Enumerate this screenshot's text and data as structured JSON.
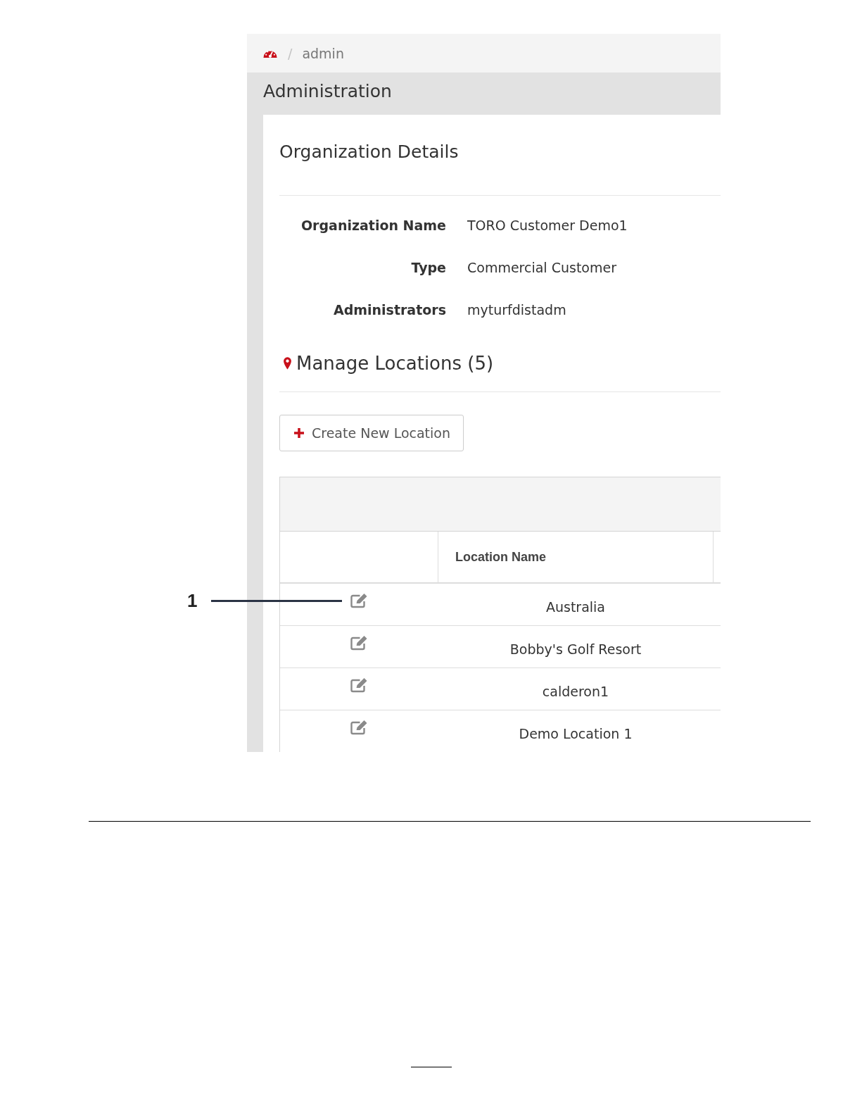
{
  "breadcrumb": {
    "separator": "/",
    "current": "admin"
  },
  "page_title": "Administration",
  "card": {
    "title": "Organization Details",
    "details": [
      {
        "label": "Organization Name",
        "value": "TORO Customer Demo1"
      },
      {
        "label": "Type",
        "value": "Commercial Customer"
      },
      {
        "label": "Administrators",
        "value": "myturfdistadm"
      }
    ],
    "locations_heading": "Manage Locations (5)",
    "create_button": "Create New Location",
    "table": {
      "columns": [
        "Location Name"
      ],
      "rows": [
        {
          "name": "Australia"
        },
        {
          "name": "Bobby's Golf Resort"
        },
        {
          "name": "calderon1"
        },
        {
          "name": "Demo Location 1"
        }
      ]
    }
  },
  "callout": {
    "label": "1"
  }
}
